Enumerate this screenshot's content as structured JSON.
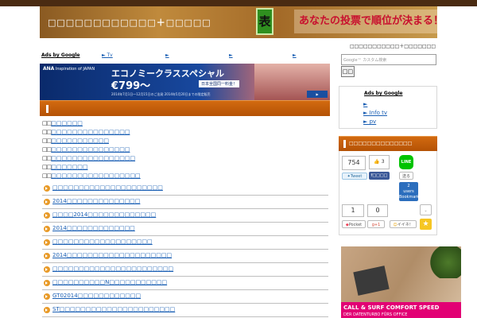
{
  "header": {
    "site_title": "□□□□□□□□□□□□＋□□□□□",
    "badge_char": "表",
    "vote_text": "あなたの投票で順位が決まる！",
    "breadcrumb": "□□□□□□□□□□□＋□□□□□□□"
  },
  "adbar": {
    "label": "Ads by Google",
    "links": [
      "► Tv",
      "►",
      "►",
      "►",
      "►"
    ]
  },
  "banner": {
    "brand_logo": "ANA",
    "brand_sub": "Inspiration of JAPAN",
    "headline": "エコノミークラススペシャル",
    "price": "€799～",
    "tag": "日本全国同一料金！",
    "fine_print": "2014年7月1日～12月15日のご出発  2014年5月20日までの限定販売"
  },
  "toc": [
    {
      "mark": "□□",
      "text": "□□□□□□"
    },
    {
      "mark": "□□",
      "text": "□□□□□□□□□□□□□□□"
    },
    {
      "mark": "□□",
      "text": "□□□□□□□□□□□"
    },
    {
      "mark": "□□",
      "text": "□□□□□□□□□□□□□□□"
    },
    {
      "mark": "□□",
      "text": "□□□□□□□□□□□□□□□□"
    },
    {
      "mark": "□□",
      "text": "□□□□□□□"
    },
    {
      "mark": "□□",
      "text": "□□□□□□□□□□□□□□□□□"
    }
  ],
  "rows": [
    "□□□□□□□□□□□□□□□□□□□□□",
    "2014□□□□□□□□□□□□□□",
    "□□□□2014□□□□□□□□□□□□□",
    "2014□□□□□□□□□□□□□",
    "□□□□□□□□□□□□□□□□□□□",
    "2014□□□□□□□□□□□□□□□□□□□□",
    "□□□□□□□□□□□□□□□□□□□□□□□",
    "□□□□□□□□□□N□□□□□□□□□□□",
    "GT02014□□□□□□□□□□□□",
    "ST□□□□□□□□□□□□□□□□□□□□□□"
  ],
  "sidebar": {
    "search_placeholder": "Google™ カスタム検索",
    "search_button": "□□",
    "ads_label": "Ads by Google",
    "ads_links": [
      "►",
      "► Info tv",
      "►      pv"
    ],
    "share_heading": "□□□□□□□□□□□□□□",
    "share": {
      "tweet_count": "754",
      "tweet_label": "Tweet",
      "like_count": "3",
      "like_label": "□□□□",
      "line_label": "LINE",
      "line_send": "送る",
      "hatena_count": "2",
      "hatena_unit": "users",
      "hatena_label": "Bookmark",
      "pocket_count": "1",
      "pocket_label": "Pocket",
      "gplus_count": "0",
      "gplus_label": "+1",
      "iine_label": "イイネ！"
    }
  },
  "ad_image": {
    "line1": "CALL & SURF COMFORT SPEED",
    "line2": "DER DATENTURBO FÜRS OFFICE"
  },
  "colors": {
    "accent": "#c45e0a",
    "link": "#1a5fb4",
    "header_brown": "#4a2b12"
  }
}
